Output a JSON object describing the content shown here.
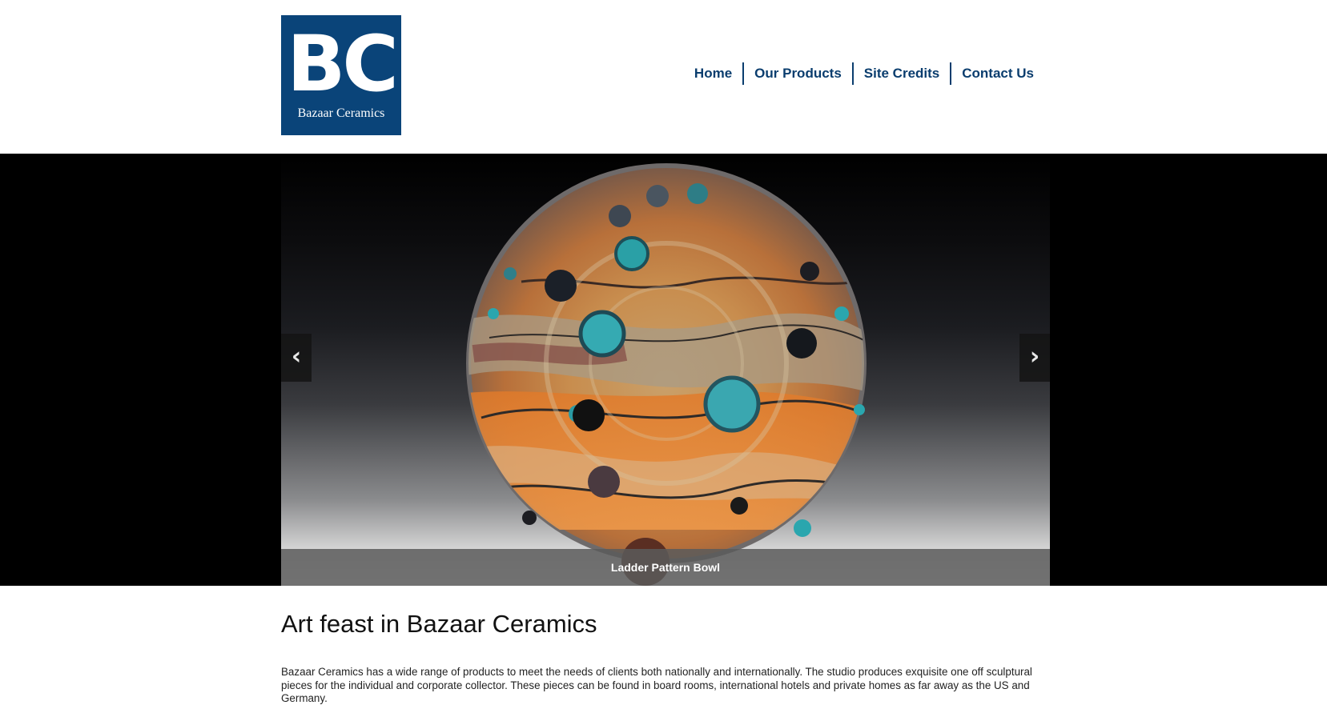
{
  "brand": {
    "mark": "BC",
    "name": "Bazaar Ceramics",
    "color": "#0a4479"
  },
  "nav": {
    "items": [
      {
        "label": "Home"
      },
      {
        "label": "Our Products"
      },
      {
        "label": "Site Credits"
      },
      {
        "label": "Contact Us"
      }
    ]
  },
  "slider": {
    "caption": "Ladder Pattern Bowl",
    "prev_icon": "chevron-left-icon",
    "next_icon": "chevron-right-icon",
    "prev_glyph": "‹",
    "next_glyph": "›"
  },
  "article": {
    "heading": "Art feast in Bazaar Ceramics",
    "body": "Bazaar Ceramics has a wide range of products to meet the needs of clients both nationally and internationally. The studio produces exquisite one off sculptural pieces for the individual and corporate collector. These pieces can be found in board rooms, international hotels and private homes as far away as the US and Germany."
  }
}
